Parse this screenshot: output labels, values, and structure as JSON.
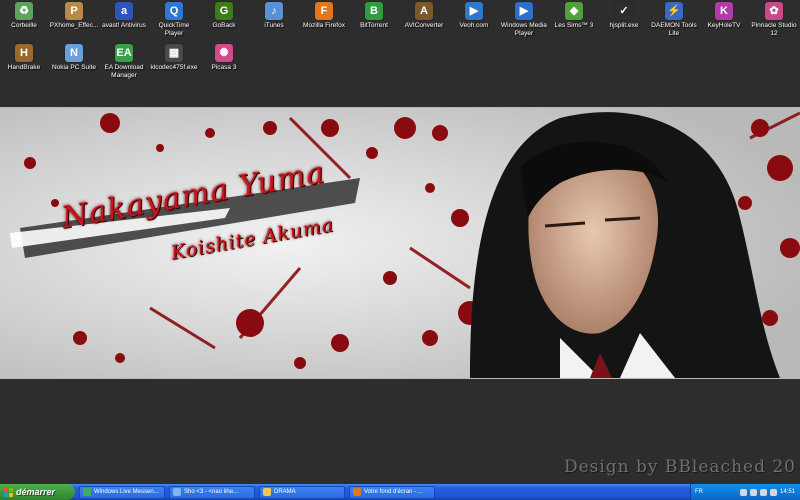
{
  "desktop": {
    "icons": [
      {
        "label": "Corbeille",
        "icon": "recycle-bin-icon",
        "color": "#5aa55a",
        "glyph": "♻"
      },
      {
        "label": "PXhome_Effec...",
        "icon": "pxhome-icon",
        "color": "#b88a4a",
        "glyph": "P"
      },
      {
        "label": "avast! Antivirus",
        "icon": "avast-icon",
        "color": "#2b55b8",
        "glyph": "a"
      },
      {
        "label": "QuickTime Player",
        "icon": "quicktime-icon",
        "color": "#2d79d1",
        "glyph": "Q"
      },
      {
        "label": "GoBack",
        "icon": "goback-icon",
        "color": "#3a7d1d",
        "glyph": "G"
      },
      {
        "label": "iTunes",
        "icon": "itunes-icon",
        "color": "#5b8fd6",
        "glyph": "♪"
      },
      {
        "label": "Mozilla Firefox",
        "icon": "firefox-icon",
        "color": "#e2761b",
        "glyph": "F"
      },
      {
        "label": "BitTorrent",
        "icon": "bittorrent-icon",
        "color": "#2e9d3f",
        "glyph": "B"
      },
      {
        "label": "AVIConverter",
        "icon": "aviconverter-icon",
        "color": "#7a5a2b",
        "glyph": "A"
      },
      {
        "label": "Veoh.com",
        "icon": "veoh-icon",
        "color": "#2f77c8",
        "glyph": "▶"
      },
      {
        "label": "Windows Media Player",
        "icon": "media-player-icon",
        "color": "#2d6fc9",
        "glyph": "▶"
      },
      {
        "label": "Les Sims™ 3",
        "icon": "sims-icon",
        "color": "#4fa23a",
        "glyph": "◆"
      },
      {
        "label": "hjsplit.exe",
        "icon": "hjsplit-icon",
        "color": "#2d2d2d",
        "glyph": "✓"
      },
      {
        "label": "DAEMON Tools Lite",
        "icon": "daemon-tools-icon",
        "color": "#3a69c2",
        "glyph": "⚡"
      },
      {
        "label": "KeyHoleTV",
        "icon": "keyholetv-icon",
        "color": "#b23aa8",
        "glyph": "K"
      },
      {
        "label": "Pinnacle Studio 12",
        "icon": "pinnacle-icon",
        "color": "#c94a8a",
        "glyph": "✿"
      },
      {
        "label": "HandBrake",
        "icon": "handbrake-icon",
        "color": "#9a6a2a",
        "glyph": "H"
      },
      {
        "label": "Nokia PC Suite",
        "icon": "nokia-icon",
        "color": "#6aa0d8",
        "glyph": "N"
      },
      {
        "label": "EA Download Manager",
        "icon": "ea-download-icon",
        "color": "#38a048",
        "glyph": "EA"
      },
      {
        "label": "klcodec475f.exe",
        "icon": "codec-installer-icon",
        "color": "#4a4a4a",
        "glyph": "▦"
      },
      {
        "label": "Picasa 3",
        "icon": "picasa-icon",
        "color": "#d34a8a",
        "glyph": "✺"
      }
    ]
  },
  "wallpaper": {
    "title": "Nakayama Yuma",
    "subtitle": "Koishite Akuma",
    "credit": "Design by BBleached 20"
  },
  "taskbar": {
    "start_label": "démarrer",
    "tasks": [
      {
        "label": "Windows Live Messen...",
        "icon": "messenger-icon",
        "color": "#3fae5a"
      },
      {
        "label": "Sho <3 - <nao iihe...",
        "icon": "chat-window-icon",
        "color": "#7cb7f0"
      },
      {
        "label": "DRAMA",
        "icon": "folder-icon",
        "color": "#f0c850"
      },
      {
        "label": "Votre fond d'écran - ...",
        "icon": "firefox-icon",
        "color": "#e2761b"
      }
    ],
    "tray": {
      "language": "FR",
      "clock": "14:51"
    }
  }
}
